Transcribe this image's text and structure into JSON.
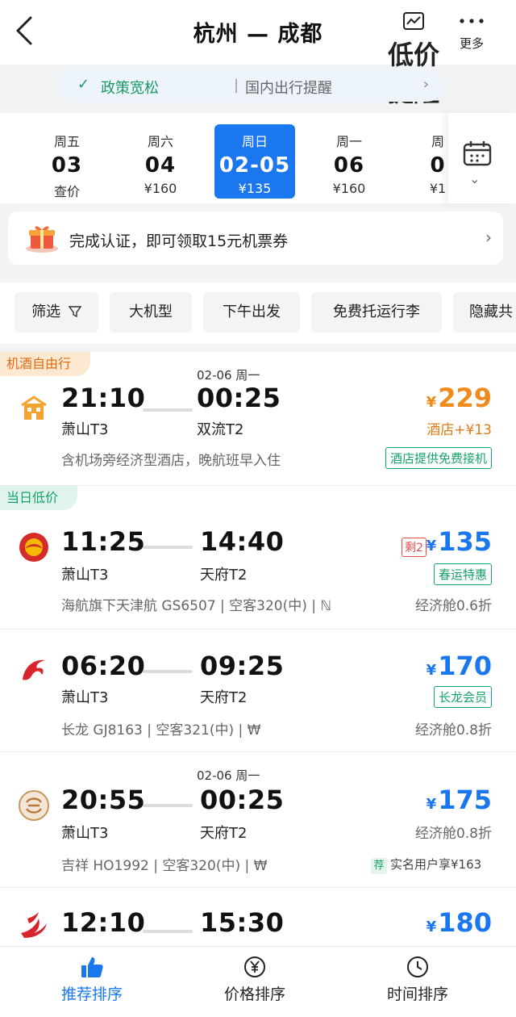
{
  "header": {
    "title": "杭州 — 成都",
    "price_alert_label": "低价提醒",
    "more_label": "更多"
  },
  "policy": {
    "status": "政策宽松",
    "separator": "|",
    "text": "国内出行提醒"
  },
  "dates": [
    {
      "weekday": "周五",
      "day": "03",
      "price": "查价"
    },
    {
      "weekday": "周六",
      "day": "04",
      "price": "¥160"
    },
    {
      "weekday": "周日",
      "day": "02-05",
      "price": "¥135",
      "selected": true
    },
    {
      "weekday": "周一",
      "day": "06",
      "price": "¥160"
    },
    {
      "weekday": "周",
      "day": "0",
      "price": "¥1"
    }
  ],
  "promo": {
    "text": "完成认证，即可领取15元机票券"
  },
  "filters": [
    "筛选",
    "大机型",
    "下午出发",
    "免费托运行李",
    "隐藏共"
  ],
  "flights": [
    {
      "tag": "机酒自由行",
      "logo": "hotel-icon",
      "dep_time": "21:10",
      "dep_airport": "萧山T3",
      "arr_date_note": "02-06 周一",
      "arr_time": "00:25",
      "arr_airport": "双流T2",
      "info": "含机场旁经济型酒店，晚航班早入住",
      "currency": "¥",
      "price": "229",
      "sub": "酒店+¥13",
      "badge": "酒店提供免费接机"
    },
    {
      "tag": "当日低价",
      "logo": "tianjin-airlines-logo",
      "dep_time": "11:25",
      "dep_airport": "萧山T3",
      "arr_time": "14:40",
      "arr_airport": "天府T2",
      "info": "海航旗下天津航 GS6507 | 空客320(中) | ",
      "remaining": "剩2",
      "currency": "¥",
      "price": "135",
      "badge": "春运特惠",
      "sub": "经济舱0.6折"
    },
    {
      "logo": "loong-air-logo",
      "dep_time": "06:20",
      "dep_airport": "萧山T3",
      "arr_time": "09:25",
      "arr_airport": "天府T2",
      "info": "长龙 GJ8163 | 空客321(中) | ",
      "currency": "¥",
      "price": "170",
      "badge": "长龙会员",
      "sub": "经济舱0.8折"
    },
    {
      "logo": "juneyao-air-logo",
      "dep_time": "20:55",
      "dep_airport": "萧山T3",
      "arr_date_note": "02-06 周一",
      "arr_time": "00:25",
      "arr_airport": "天府T2",
      "info": "吉祥 HO1992 | 空客320(中) | ",
      "currency": "¥",
      "price": "175",
      "sub": "经济舱0.8折",
      "rec_icon": "荐",
      "rec_text": "实名用户享¥163"
    },
    {
      "logo": "sichuan-airlines-logo",
      "dep_time": "12:10",
      "arr_time": "15:30",
      "currency": "¥",
      "price": "180"
    }
  ],
  "bottom_tabs": [
    {
      "label": "推荐排序",
      "icon": "thumbs-up-icon",
      "active": true
    },
    {
      "label": "价格排序",
      "icon": "yen-circle-icon"
    },
    {
      "label": "时间排序",
      "icon": "clock-icon"
    }
  ]
}
